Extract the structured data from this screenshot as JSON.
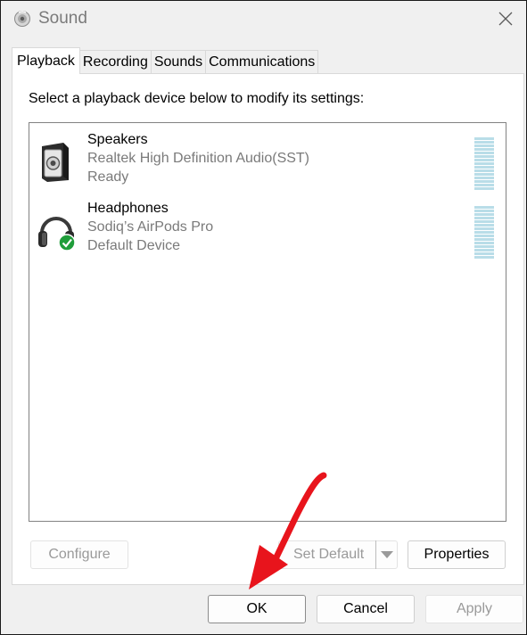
{
  "window": {
    "title": "Sound"
  },
  "tabs": [
    {
      "label": "Playback",
      "active": true
    },
    {
      "label": "Recording",
      "active": false
    },
    {
      "label": "Sounds",
      "active": false
    },
    {
      "label": "Communications",
      "active": false
    }
  ],
  "playback": {
    "instruction": "Select a playback device below to modify its settings:",
    "devices": [
      {
        "name": "Speakers",
        "description": "Realtek High Definition Audio(SST)",
        "status": "Ready",
        "icon": "speaker-icon"
      },
      {
        "name": "Headphones",
        "description": "Sodiq’s AirPods Pro",
        "status": "Default Device",
        "icon": "headphones-icon",
        "badge": "default-check-icon"
      }
    ],
    "buttons": {
      "configure": "Configure",
      "set_default": "Set Default",
      "properties": "Properties"
    }
  },
  "footer": {
    "ok": "OK",
    "cancel": "Cancel",
    "apply": "Apply"
  },
  "colors": {
    "meter": "#b9dde8",
    "check_badge": "#1f9d3a",
    "annotation_arrow": "#e8141c"
  }
}
